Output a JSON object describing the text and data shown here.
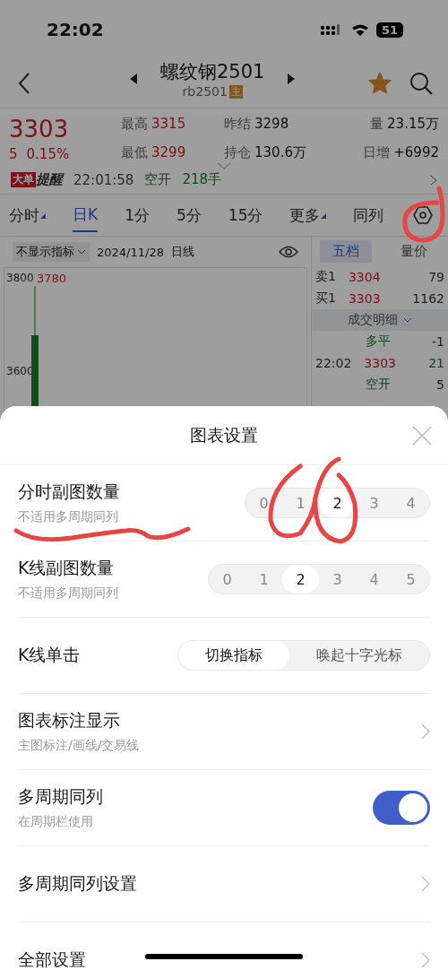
{
  "status_bar": {
    "time": "22:02",
    "battery": "51"
  },
  "header": {
    "title": "螺纹钢2501",
    "code": "rb2501",
    "badge": "主",
    "favorited": true
  },
  "quote": {
    "price": "3303",
    "change": "5",
    "change_pct": "0.15%",
    "stats": [
      {
        "label": "最高",
        "value": "3315",
        "kind": "price"
      },
      {
        "label": "昨结",
        "value": "3298",
        "kind": "plain"
      },
      {
        "label": "量",
        "value": "23.15万",
        "kind": "plain"
      },
      {
        "label": "最低",
        "value": "3299",
        "kind": "price"
      },
      {
        "label": "持仓",
        "value": "130.6万",
        "kind": "plain"
      },
      {
        "label": "日增",
        "value": "+6992",
        "kind": "plain"
      }
    ]
  },
  "alert": {
    "tag": "大单",
    "label": "提醒",
    "time": "22:01:58",
    "action": "空开",
    "volume": "218手"
  },
  "period_tabs": [
    {
      "label": "分时",
      "selected": false,
      "dropdown": true
    },
    {
      "label": "日K",
      "selected": true,
      "dropdown": false
    },
    {
      "label": "1分",
      "selected": false,
      "dropdown": false
    },
    {
      "label": "5分",
      "selected": false,
      "dropdown": false
    },
    {
      "label": "15分",
      "selected": false,
      "dropdown": false
    },
    {
      "label": "更多",
      "selected": false,
      "dropdown": true
    },
    {
      "label": "同列",
      "selected": false,
      "dropdown": false
    }
  ],
  "chart_toolbar": {
    "indicator": "不显示指标",
    "date": "2024/11/28",
    "period": "日线"
  },
  "chart": {
    "axis_labels": [
      "3800",
      "3600"
    ],
    "high_label": "3780"
  },
  "book_tabs": [
    {
      "label": "五档",
      "selected": true
    },
    {
      "label": "量价",
      "selected": false
    }
  ],
  "book": [
    {
      "label": "卖1",
      "price": "3304",
      "volume": "79"
    },
    {
      "label": "买1",
      "price": "3303",
      "volume": "1162"
    }
  ],
  "trades_header": "成交明细",
  "trades": [
    {
      "kind": "type",
      "type": "多平",
      "volume": "-1"
    },
    {
      "kind": "trade",
      "time": "22:02",
      "price": "3303",
      "volume": "21"
    },
    {
      "kind": "type",
      "type": "空开",
      "volume": "5"
    }
  ],
  "sheet": {
    "title": "图表设置",
    "rows": [
      {
        "kind": "segmented",
        "label": "分时副图数量",
        "hint": "不适用多周期同列",
        "options": [
          {
            "label": "0",
            "selected": false
          },
          {
            "label": "1",
            "selected": false
          },
          {
            "label": "2",
            "selected": true
          },
          {
            "label": "3",
            "selected": false
          },
          {
            "label": "4",
            "selected": false
          }
        ]
      },
      {
        "kind": "segmented",
        "label": "K线副图数量",
        "hint": "不适用多周期同列",
        "options": [
          {
            "label": "0",
            "selected": false
          },
          {
            "label": "1",
            "selected": false
          },
          {
            "label": "2",
            "selected": true
          },
          {
            "label": "3",
            "selected": false
          },
          {
            "label": "4",
            "selected": false
          },
          {
            "label": "5",
            "selected": false
          }
        ]
      },
      {
        "kind": "choice",
        "label": "K线单击",
        "options": [
          {
            "label": "切换指标",
            "selected": true
          },
          {
            "label": "唤起十字光标",
            "selected": false
          }
        ]
      },
      {
        "kind": "link",
        "label": "图表标注显示",
        "hint": "主图标注/画线/交易线"
      },
      {
        "kind": "toggle",
        "label": "多周期同列",
        "hint": "在周期栏使用",
        "on": true
      },
      {
        "kind": "link",
        "label": "多周期同列设置"
      },
      {
        "kind": "link",
        "label": "全部设置"
      }
    ]
  }
}
